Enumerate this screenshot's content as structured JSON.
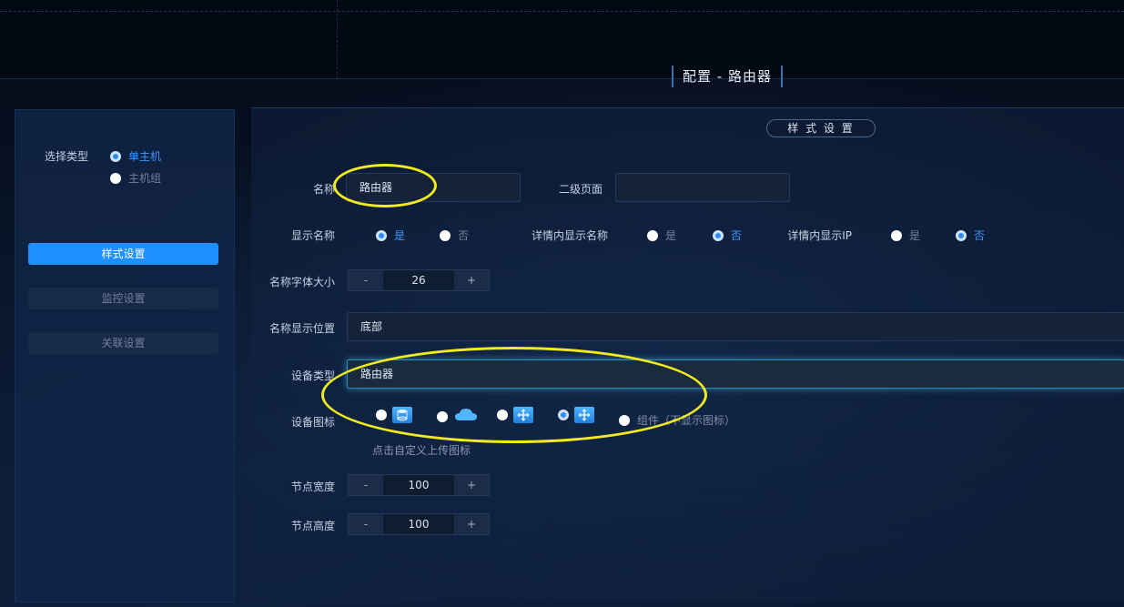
{
  "header": {
    "title": "配置 - 路由器"
  },
  "sidebar": {
    "select_type_label": "选择类型",
    "options": [
      {
        "label": "单主机",
        "selected": true
      },
      {
        "label": "主机组",
        "selected": false
      }
    ],
    "buttons": [
      {
        "label": "样式设置",
        "active": true
      },
      {
        "label": "监控设置",
        "active": false
      },
      {
        "label": "关联设置",
        "active": false
      }
    ]
  },
  "main": {
    "section_title": "样 式 设 置",
    "name_label": "名称",
    "name_value": "路由器",
    "secondary_page_label": "二级页面",
    "secondary_page_value": "",
    "show_name": {
      "label": "显示名称",
      "yes": "是",
      "no": "否",
      "selected": "yes"
    },
    "detail_show_name": {
      "label": "详情内显示名称",
      "yes": "是",
      "no": "否",
      "selected": "no"
    },
    "detail_show_ip": {
      "label": "详情内显示IP",
      "yes": "是",
      "no": "否",
      "selected": "no"
    },
    "font_size": {
      "label": "名称字体大小",
      "value": "26",
      "minus": "-",
      "plus": "+"
    },
    "name_position": {
      "label": "名称显示位置",
      "value": "底部"
    },
    "device_type": {
      "label": "设备类型",
      "value": "路由器"
    },
    "device_icon": {
      "label": "设备图标",
      "icons": [
        "database-icon",
        "cloud-icon",
        "router-icon",
        "router-icon"
      ],
      "selected_index": 3,
      "extra_option": "组件（不显示图标）",
      "upload_hint": "点击自定义上传图标"
    },
    "node_width": {
      "label": "节点宽度",
      "value": "100",
      "minus": "-",
      "plus": "+"
    },
    "node_height": {
      "label": "节点高度",
      "value": "100",
      "minus": "-",
      "plus": "+"
    }
  },
  "colors": {
    "accent": "#1e90ff",
    "annotation": "#f1ea1f"
  }
}
